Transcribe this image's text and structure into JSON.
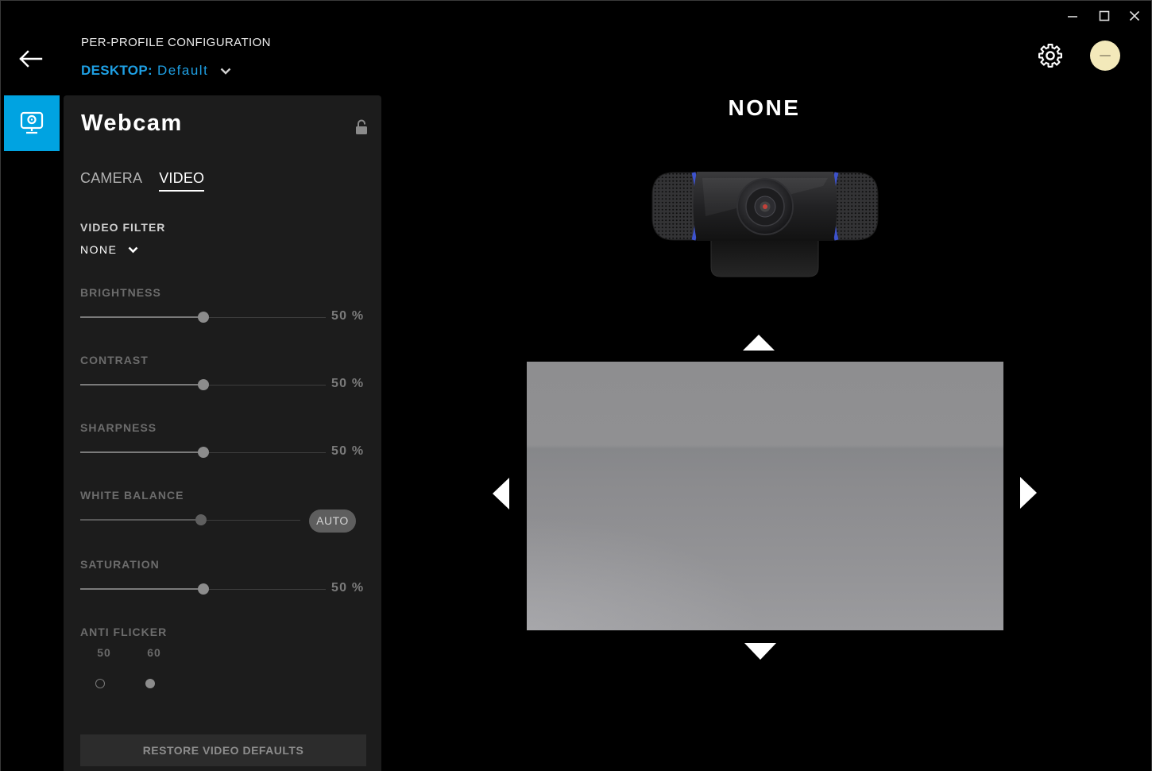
{
  "colors": {
    "accent": "#1e9fe3",
    "tile": "#00a3e1",
    "panel": "#1c1c1c",
    "window_bg": "#000000"
  },
  "window_controls": {
    "minimize": "minimize-icon",
    "maximize": "maximize-icon",
    "close": "close-icon"
  },
  "header": {
    "back_icon": "back-arrow-icon",
    "section_title": "PER-PROFILE CONFIGURATION",
    "profile_label": "DESKTOP:",
    "profile_value": "Default",
    "profile_dropdown_icon": "chevron-down-icon",
    "settings_icon": "gear-icon",
    "avatar_icon": "user-avatar"
  },
  "sidebar": {
    "items": [
      {
        "icon": "webcam-icon",
        "active": true
      }
    ]
  },
  "panel": {
    "title": "Webcam",
    "lock_icon": "unlocked-padlock-icon",
    "tabs": [
      {
        "label": "CAMERA",
        "active": false
      },
      {
        "label": "VIDEO",
        "active": true
      }
    ],
    "video_filter": {
      "label": "VIDEO FILTER",
      "value": "NONE"
    },
    "sliders": [
      {
        "label": "BRIGHTNESS",
        "value": 50,
        "display": "50 %"
      },
      {
        "label": "CONTRAST",
        "value": 50,
        "display": "50 %"
      },
      {
        "label": "SHARPNESS",
        "value": 50,
        "display": "50 %"
      },
      {
        "label": "WHITE BALANCE",
        "value": 55,
        "auto_label": "AUTO"
      },
      {
        "label": "SATURATION",
        "value": 50,
        "display": "50 %"
      }
    ],
    "anti_flicker": {
      "label": "ANTI FLICKER",
      "options": [
        {
          "label": "50",
          "selected": false
        },
        {
          "label": "60",
          "selected": true
        }
      ]
    },
    "restore_button": "RESTORE VIDEO DEFAULTS"
  },
  "preview": {
    "filter_title": "NONE",
    "nav_icons": [
      "arrow-up-icon",
      "arrow-left-icon",
      "arrow-right-icon",
      "arrow-down-icon"
    ]
  }
}
